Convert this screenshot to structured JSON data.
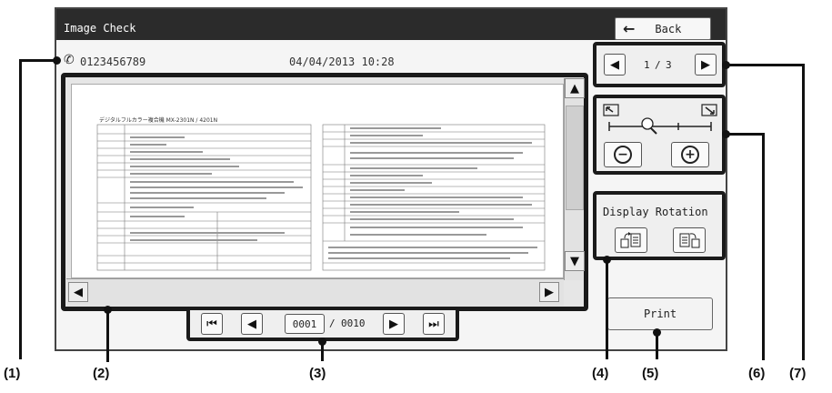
{
  "window": {
    "title": "Image Check",
    "back_label": "Back"
  },
  "info": {
    "phone_number": "0123456789",
    "datetime": "04/04/2013  10:28"
  },
  "document": {
    "heading": "デジタルフルカラー複合機 MX-2301N / 4201N"
  },
  "page_nav_top": {
    "current": "1",
    "separator": "/",
    "total": "3"
  },
  "page_nav_bottom": {
    "current": "0001",
    "separator": "/",
    "total": "0010"
  },
  "rotation": {
    "label": "Display Rotation"
  },
  "print": {
    "label": "Print"
  },
  "callouts": [
    "(1)",
    "(2)",
    "(3)",
    "(4)",
    "(5)",
    "(6)",
    "(7)"
  ],
  "icons": {
    "phone": "phone-icon",
    "back": "back-arrow-icon",
    "first": "first-page-icon",
    "prev": "prev-page-icon",
    "next": "next-page-icon",
    "last": "last-page-icon",
    "zoom_out": "zoom-out-icon",
    "zoom_in": "zoom-in-icon",
    "magnifier": "magnifier-icon",
    "rotate_left": "rotate-left-icon",
    "rotate_right": "rotate-right-icon"
  }
}
